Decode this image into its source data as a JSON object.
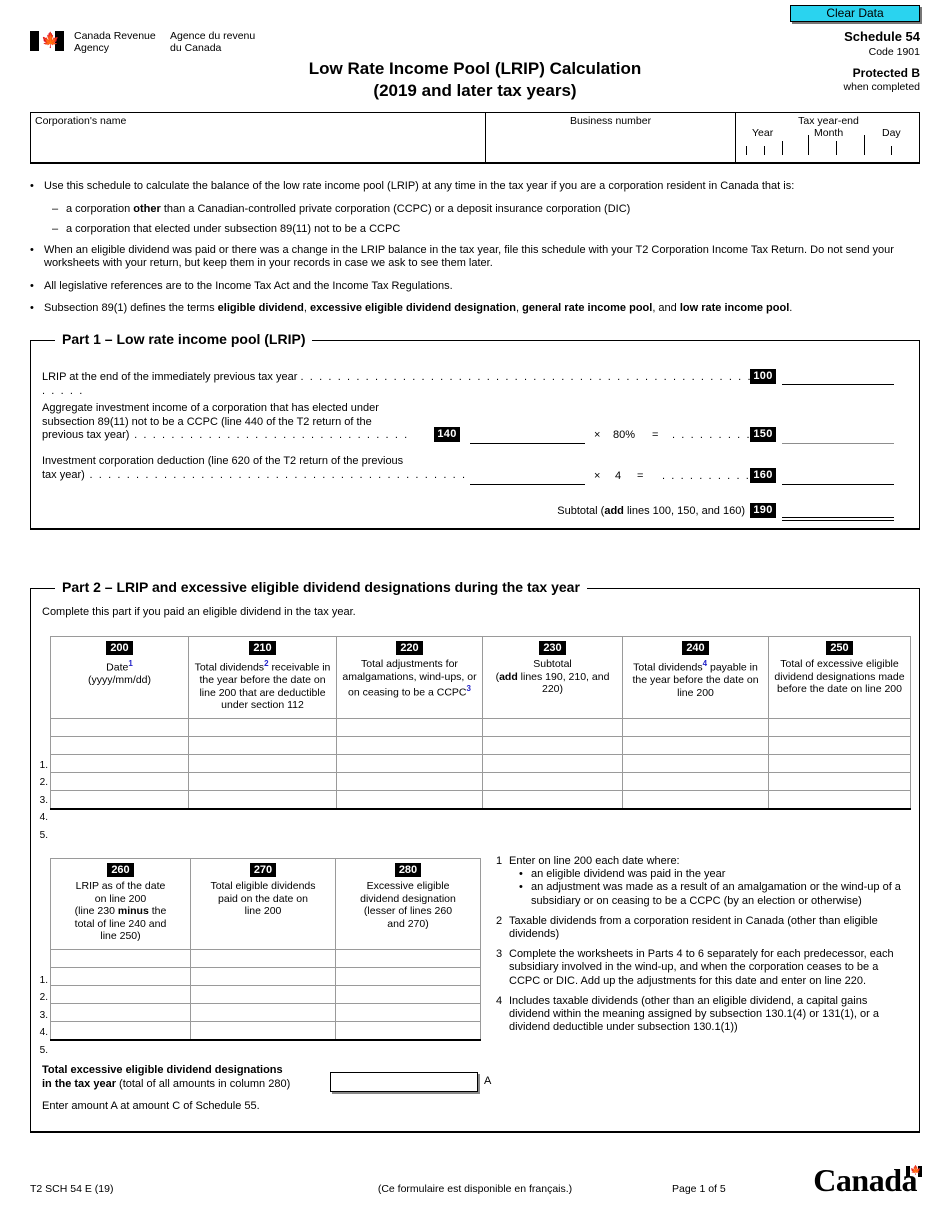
{
  "clear_data_button": "Clear Data",
  "agency": {
    "en": "Canada Revenue\nAgency",
    "fr": "Agence du revenu\ndu Canada",
    "flag_icon": "canada-flag-icon"
  },
  "title": {
    "line1": "Low Rate Income Pool (LRIP) Calculation",
    "line2": "(2019 and later tax years)"
  },
  "right_header": {
    "schedule": "Schedule 54",
    "code": "Code 1901",
    "protected": "Protected B",
    "when_completed": "when completed"
  },
  "identification": {
    "corporation_name_label": "Corporation's name",
    "business_number_label": "Business number",
    "tax_year_end_label": "Tax year-end",
    "year_label": "Year",
    "month_label": "Month",
    "day_label": "Day",
    "corporation_name_value": "",
    "business_number_value": ""
  },
  "instructions": [
    {
      "mark": "•",
      "text": "Use this schedule to calculate the balance of the low rate income pool (LRIP) at any time in the tax year if you are a corporation resident in Canada that is:",
      "type": "bullet"
    },
    {
      "mark": "–",
      "text_pre": "a corporation ",
      "text_bold": "other",
      "text_post": " than a Canadian-controlled private corporation (CCPC) or a deposit insurance corporation (DIC)",
      "type": "dash"
    },
    {
      "mark": "–",
      "text": "a corporation that elected under subsection 89(11) not to be a CCPC",
      "type": "dash"
    },
    {
      "mark": "•",
      "text": "When an eligible dividend was paid or there was a change in the LRIP balance in the tax year, file this schedule with your T2 Corporation Income Tax Return. Do not send your worksheets with your return, but keep them in your records in case we ask to see them later.",
      "type": "bullet"
    },
    {
      "mark": "•",
      "text": "All legislative references are to the Income Tax Act and the Income Tax Regulations.",
      "type": "bullet"
    }
  ],
  "subsection_note": {
    "mark": "•",
    "pre": "Subsection 89(1) defines the terms ",
    "t1": "eligible dividend",
    "sep1": ", ",
    "t2": "excessive eligible dividend designation",
    "sep2": ", ",
    "t3": "general rate income pool",
    "sep3": ", and ",
    "t4": "low rate income pool",
    "end": "."
  },
  "part1": {
    "title": "Part 1 – Low rate income pool (LRIP)",
    "line100": {
      "label": "LRIP at the end of the immediately previous tax year",
      "code": "100",
      "value": ""
    },
    "line140": {
      "label_l1": "Aggregate investment income of a corporation that has elected under",
      "label_l2": "subsection 89(11) not to be a CCPC (line 440 of the T2 return of the",
      "label_l3": "previous tax year)",
      "code": "140",
      "value": "",
      "operator": "×",
      "factor": "80%",
      "equals": "=",
      "result_code": "150",
      "result_value": ""
    },
    "line160": {
      "label_l1": "Investment corporation deduction (line 620 of the T2 return of the previous",
      "label_l2": "tax year)",
      "value": "",
      "operator": "×",
      "factor": "4",
      "equals": "=",
      "result_code": "160",
      "result_value": ""
    },
    "subtotal": {
      "label_pre": "Subtotal (",
      "label_bold": "add",
      "label_post": " lines 100, 150, and 160)",
      "code": "190",
      "value": ""
    }
  },
  "part2": {
    "title": "Part 2 – LRIP and excessive eligible dividend designations during the tax year",
    "intro": "Complete this part if you paid an eligible dividend in the tax year.",
    "table_a": {
      "columns": [
        {
          "code": "200",
          "lines": [
            "Date ¹",
            "(yyyy/mm/dd)"
          ],
          "sup": "1",
          "head_main": "Date",
          "head_sub": "(yyyy/mm/dd)"
        },
        {
          "code": "210",
          "head_main": "Total dividends",
          "sup": "2",
          "head_rest": "receivable in the year before the date on line 200 that are deductible under section 112"
        },
        {
          "code": "220",
          "head_main": "Total adjustments for amalgamations, wind-ups, or on ceasing to be a CCPC",
          "sup": "3",
          "head_rest": ""
        },
        {
          "code": "230",
          "head_main": "Subtotal",
          "head_bold_pre": "(",
          "head_bold": "add",
          "head_bold_post": " lines 190, 210, and 220)"
        },
        {
          "code": "240",
          "head_main": "Total dividends",
          "sup": "4",
          "head_rest": "payable in the year before the date on line 200"
        },
        {
          "code": "250",
          "head_main": "Total of excessive eligible dividend designations made before the date on line 200"
        }
      ],
      "row_numbers": [
        "1.",
        "2.",
        "3.",
        "4.",
        "5."
      ],
      "rows": [
        [
          "",
          "",
          "",
          "",
          "",
          ""
        ],
        [
          "",
          "",
          "",
          "",
          "",
          ""
        ],
        [
          "",
          "",
          "",
          "",
          "",
          ""
        ],
        [
          "",
          "",
          "",
          "",
          "",
          ""
        ],
        [
          "",
          "",
          "",
          "",
          "",
          ""
        ]
      ]
    },
    "table_b": {
      "columns": [
        {
          "code": "260",
          "head_l1": "LRIP as of the date",
          "head_l2": "on line 200",
          "head_l3_pre": "(line 230 ",
          "head_l3_bold": "minus",
          "head_l3_post": " the",
          "head_l4": "total of line 240 and",
          "head_l5": "line 250)"
        },
        {
          "code": "270",
          "head_l1": "Total eligible dividends",
          "head_l2": "paid on the date on",
          "head_l3": "line 200"
        },
        {
          "code": "280",
          "head_l1": "Excessive eligible",
          "head_l2": "dividend designation",
          "head_l3": "(lesser of lines 260",
          "head_l4": "and 270)"
        }
      ],
      "row_numbers": [
        "1.",
        "2.",
        "3.",
        "4.",
        "5."
      ],
      "rows": [
        [
          "",
          "",
          ""
        ],
        [
          "",
          "",
          ""
        ],
        [
          "",
          "",
          ""
        ],
        [
          "",
          "",
          ""
        ],
        [
          "",
          "",
          ""
        ]
      ]
    },
    "footnotes": [
      {
        "n": "1",
        "text": "Enter on line 200 each date where:",
        "sub": [
          "an eligible dividend was paid in the year",
          "an adjustment was made as a result of an amalgamation or the wind-up of a subsidiary or on ceasing to be a CCPC (by an election or otherwise)"
        ]
      },
      {
        "n": "2",
        "text": "Taxable dividends from a corporation resident in Canada (other than eligible dividends)",
        "sub": []
      },
      {
        "n": "3",
        "text": "Complete the worksheets in Parts 4 to 6 separately for each predecessor, each subsidiary involved in the wind-up, and when the corporation ceases to be a CCPC or DIC. Add up the adjustments for this date and enter on line 220.",
        "sub": []
      },
      {
        "n": "4",
        "text": "Includes taxable dividends (other than an eligible dividend, a capital gains dividend within the meaning assigned by subsection 130.1(4) or 131(1), or a dividend deductible under subsection 130.1(1))",
        "sub": []
      }
    ],
    "total_line": {
      "bold_l1": "Total excessive eligible dividend designations",
      "bold_l2": "in the tax year",
      "normal_l2": " (total of all amounts in column 280)",
      "value": "",
      "amount_letter": "A"
    },
    "enter_amount": "Enter amount A at amount C of Schedule 55."
  },
  "footer": {
    "form_code": "T2 SCH 54 E (19)",
    "french_note": "(Ce formulaire est disponible en français.)",
    "page": "Page 1 of 5",
    "wordmark": "Canada"
  },
  "colors": {
    "clear_data_bg": "#2ad3ef",
    "line_box_bg": "#000000",
    "superscript": "#2323c8"
  }
}
